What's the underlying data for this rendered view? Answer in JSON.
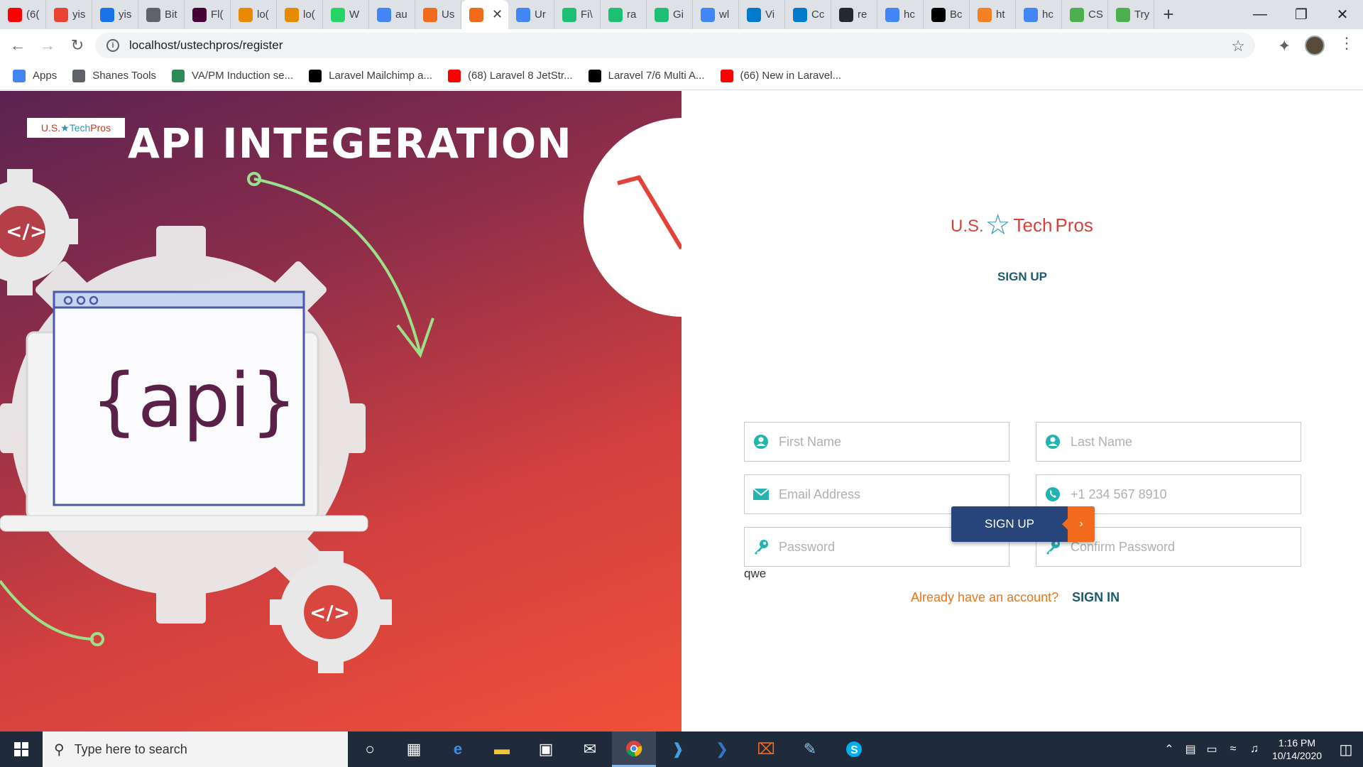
{
  "browser": {
    "tabs": [
      {
        "label": "(6(",
        "icon": "youtube-icon",
        "color": "#ff0000"
      },
      {
        "label": "yis",
        "icon": "gmail-icon",
        "color": "#ea4335"
      },
      {
        "label": "yis",
        "icon": "shield-icon",
        "color": "#1a73e8"
      },
      {
        "label": "Bit",
        "icon": "globe-icon",
        "color": "#5f6368"
      },
      {
        "label": "Fl(",
        "icon": "xd-icon",
        "color": "#470137"
      },
      {
        "label": "lo(",
        "icon": "phpmyadmin-icon",
        "color": "#e68a00"
      },
      {
        "label": "lo(",
        "icon": "phpmyadmin-icon",
        "color": "#e68a00"
      },
      {
        "label": "W",
        "icon": "whatsapp-icon",
        "color": "#25d366"
      },
      {
        "label": "au",
        "icon": "google-icon",
        "color": "#4285f4"
      },
      {
        "label": "Us",
        "icon": "xampp-icon",
        "color": "#f26a1b"
      },
      {
        "label": "",
        "icon": "xampp-icon",
        "color": "#f26a1b",
        "active": true
      },
      {
        "label": "Ur",
        "icon": "google-icon",
        "color": "#4285f4"
      },
      {
        "label": "Fi\\",
        "icon": "fiverr-icon",
        "color": "#1dbf73"
      },
      {
        "label": "ra",
        "icon": "fiverr-icon",
        "color": "#1dbf73"
      },
      {
        "label": "Gi",
        "icon": "fiverr-icon",
        "color": "#1dbf73"
      },
      {
        "label": "wl",
        "icon": "google-icon",
        "color": "#4285f4"
      },
      {
        "label": "Vi",
        "icon": "vscode-icon",
        "color": "#007acc"
      },
      {
        "label": "Cc",
        "icon": "vscode-icon",
        "color": "#007acc"
      },
      {
        "label": "re",
        "icon": "github-icon",
        "color": "#24292e"
      },
      {
        "label": "hc",
        "icon": "google-icon",
        "color": "#4285f4"
      },
      {
        "label": "Bc",
        "icon": "codepen-icon",
        "color": "#000000"
      },
      {
        "label": "ht",
        "icon": "stackoverflow-icon",
        "color": "#f48024"
      },
      {
        "label": "hc",
        "icon": "google-icon",
        "color": "#4285f4"
      },
      {
        "label": "CS",
        "icon": "w3-icon",
        "color": "#4caf50"
      },
      {
        "label": "Try",
        "icon": "w3-icon",
        "color": "#4caf50"
      }
    ],
    "url": "localhost/ustechpros/register",
    "bookmarks": [
      {
        "label": "Apps",
        "icon": "apps-grid-icon",
        "color": "#4285f4"
      },
      {
        "label": "Shanes Tools",
        "icon": "globe-icon",
        "color": "#5f6368"
      },
      {
        "label": "VA/PM Induction se...",
        "icon": "t-icon",
        "color": "#2e8b57"
      },
      {
        "label": "Laravel Mailchimp a...",
        "icon": "dev-icon",
        "color": "#000000"
      },
      {
        "label": "(68) Laravel 8 JetStr...",
        "icon": "youtube-icon",
        "color": "#ff0000"
      },
      {
        "label": "Laravel 7/6 Multi A...",
        "icon": "dev-icon",
        "color": "#000000"
      },
      {
        "label": "(66) New in Laravel...",
        "icon": "youtube-icon",
        "color": "#ff0000"
      }
    ]
  },
  "hero": {
    "logo_us": "U.S.",
    "logo_tech": "Tech",
    "logo_pros": "Pros",
    "title": "API INTEGERATION",
    "api_text": "{api}"
  },
  "form": {
    "brand_us": "U.S.",
    "brand_tech": "Tech",
    "brand_pros": "Pros",
    "title": "SIGN UP",
    "first_name_placeholder": "First Name",
    "last_name_placeholder": "Last Name",
    "email_placeholder": "Email Address",
    "phone_placeholder": "+1 234 567 8910",
    "password_placeholder": "Password",
    "confirm_password_placeholder": "Confirm Password",
    "submit_label": "SIGN UP",
    "debug_text": "qwe",
    "signin_question": "Already have an account?",
    "signin_link": "SIGN IN",
    "accent_teal": "#22b4b0",
    "accent_orange": "#f26a1b",
    "button_blue": "#27457a"
  },
  "taskbar": {
    "search_placeholder": "Type here to search",
    "time": "1:16 PM",
    "date": "10/14/2020"
  }
}
